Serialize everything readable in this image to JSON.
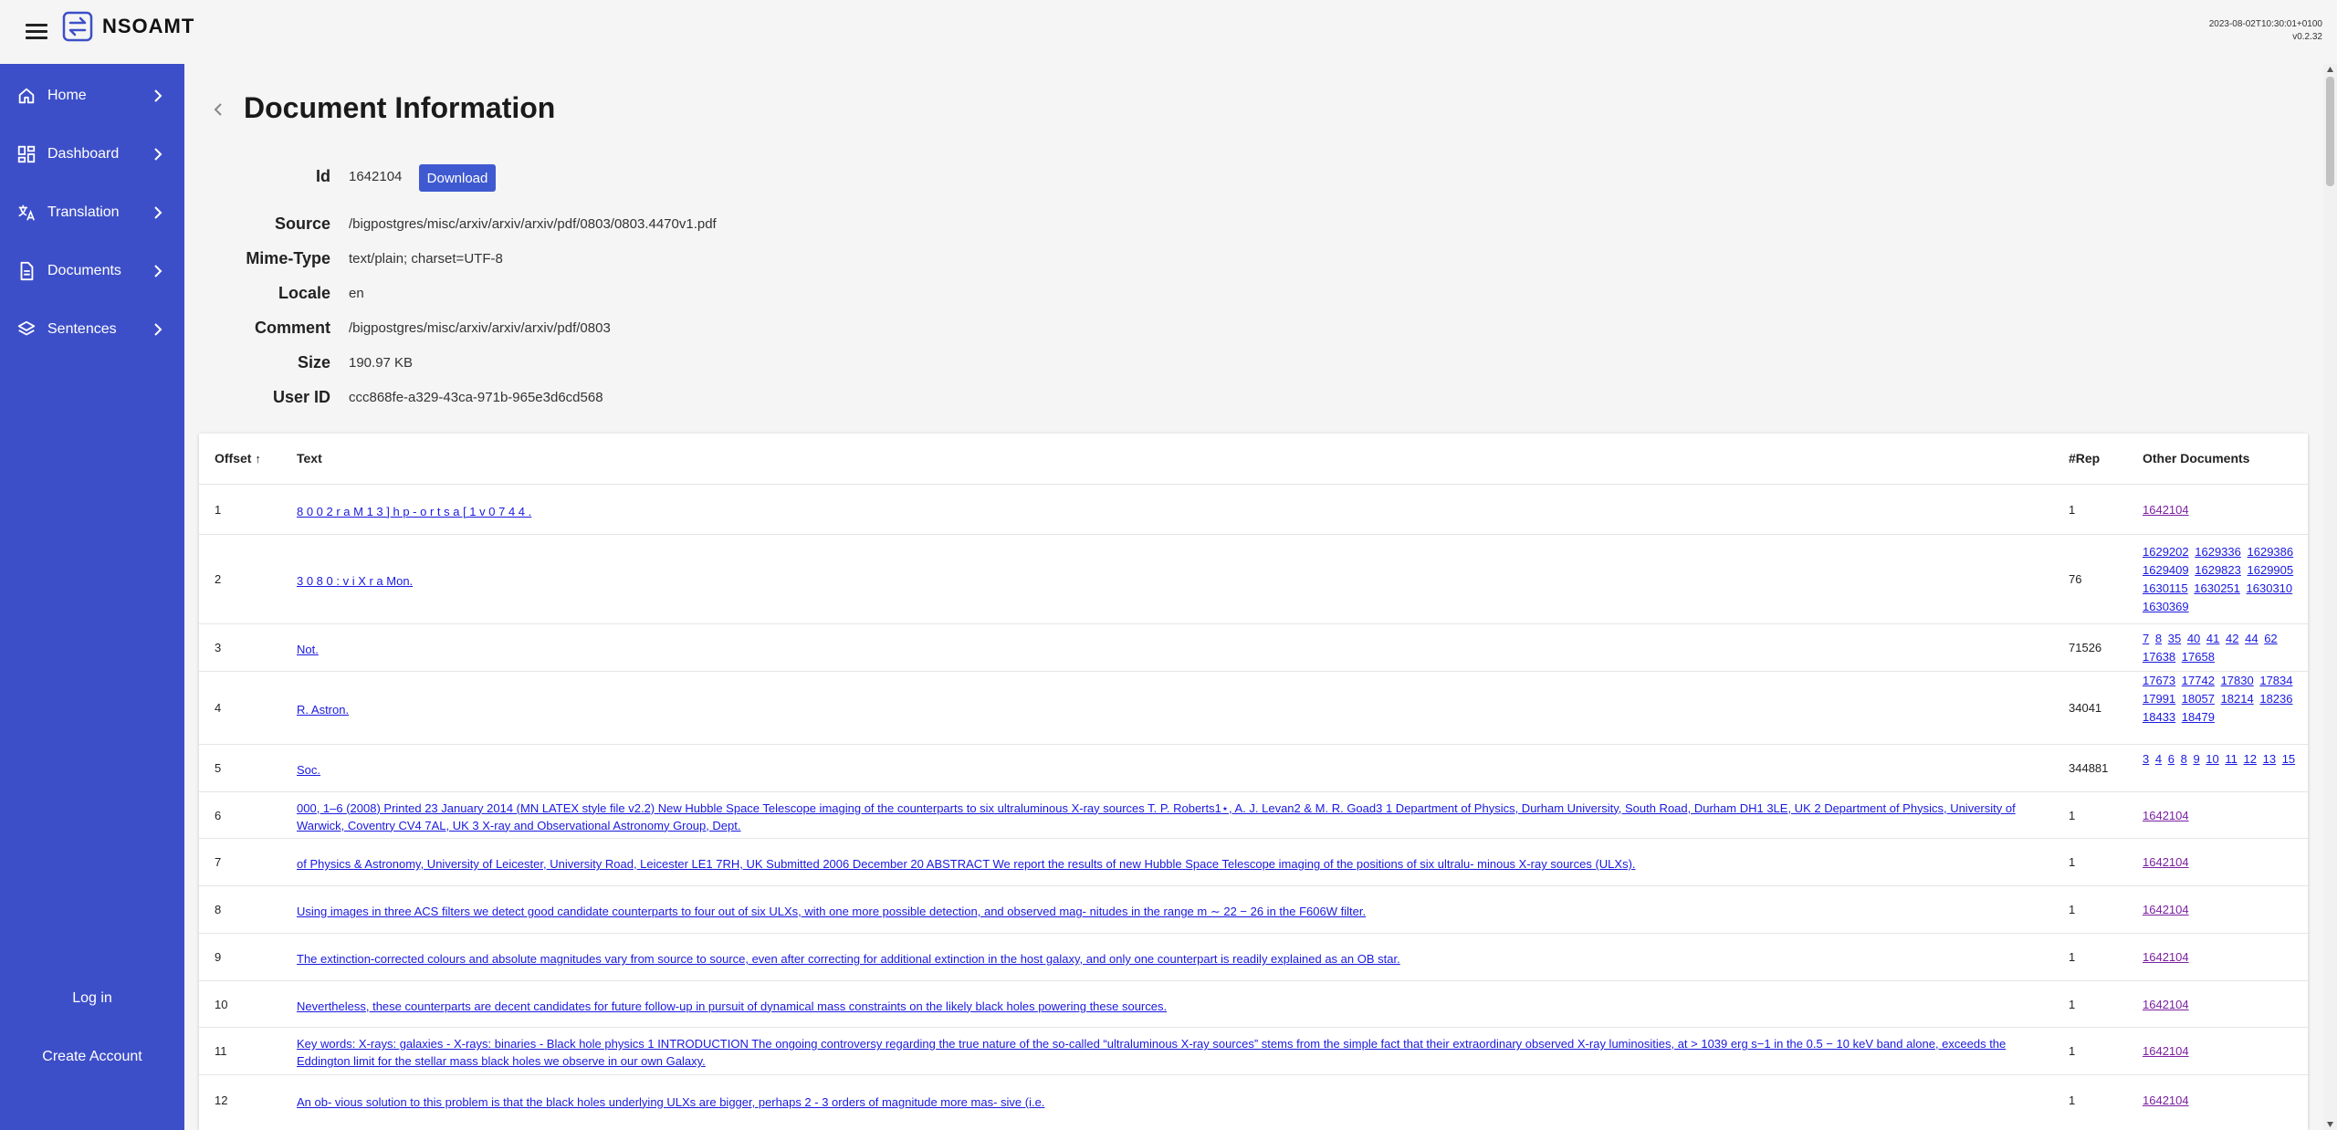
{
  "app": {
    "brand": "NSOAMT",
    "build_timestamp": "2023-08-02T10:30:01+0100",
    "version": "v0.2.32"
  },
  "sidebar": {
    "items": [
      {
        "label": "Home",
        "icon": "home-icon"
      },
      {
        "label": "Dashboard",
        "icon": "dashboard-icon"
      },
      {
        "label": "Translation",
        "icon": "translate-icon"
      },
      {
        "label": "Documents",
        "icon": "document-icon"
      },
      {
        "label": "Sentences",
        "icon": "layers-icon"
      }
    ],
    "login": "Log in",
    "create_account": "Create Account",
    "background": "#3d4fc8"
  },
  "page": {
    "title": "Document Information"
  },
  "info": {
    "id_label": "Id",
    "id": "1642104",
    "download": "Download",
    "source_label": "Source",
    "source": "/bigpostgres/misc/arxiv/arxiv/arxiv/pdf/0803/0803.4470v1.pdf",
    "mime_label": "Mime-Type",
    "mime": "text/plain; charset=UTF-8",
    "locale_label": "Locale",
    "locale": "en",
    "comment_label": "Comment",
    "comment": "/bigpostgres/misc/arxiv/arxiv/arxiv/pdf/0803",
    "size_label": "Size",
    "size": "190.97 KB",
    "user_label": "User ID",
    "user": "ccc868fe-a329-43ca-971b-965e3d6cd568"
  },
  "table": {
    "headers": {
      "offset": "Offset",
      "text": "Text",
      "rep": "#Rep",
      "docs": "Other Documents"
    },
    "rows": [
      {
        "offset": "1",
        "text": "8 0 0 2 r a M 1 3 ] h p - o r t s a [ 1 v 0 7 4 4 .",
        "rep": "1",
        "docs": [
          "1642104"
        ]
      },
      {
        "offset": "2",
        "text": "3 0 8 0 : v i X r a Mon.",
        "rep": "76",
        "docs": [
          "1629202",
          "1629336",
          "1629386",
          "1629409",
          "1629823",
          "1629905",
          "1630115",
          "1630251",
          "1630310",
          "1630369"
        ]
      },
      {
        "offset": "3",
        "text": "Not.",
        "rep": "71526",
        "docs": [
          "7",
          "8",
          "35",
          "40",
          "41",
          "42",
          "44",
          "62",
          "17638",
          "17658"
        ]
      },
      {
        "offset": "4",
        "text": "R. Astron.",
        "rep": "34041",
        "docs": [
          "17673",
          "17742",
          "17830",
          "17834",
          "17991",
          "18057",
          "18214",
          "18236",
          "18433",
          "18479"
        ]
      },
      {
        "offset": "5",
        "text": "Soc.",
        "rep": "344881",
        "docs": [
          "3",
          "4",
          "6",
          "8",
          "9",
          "10",
          "11",
          "12",
          "13",
          "15"
        ]
      },
      {
        "offset": "6",
        "text": "000, 1–6 (2008) Printed 23 January 2014 (MN LATEX style file v2.2) New Hubble Space Telescope imaging of the counterparts to six ultraluminous X-ray sources T. P. Roberts1⋆, A. J. Levan2 & M. R. Goad3 1 Department of Physics, Durham University, South Road, Durham DH1 3LE, UK 2 Department of Physics, University of Warwick, Coventry CV4 7AL, UK 3 X-ray and Observational Astronomy Group, Dept.",
        "rep": "1",
        "docs": [
          "1642104"
        ]
      },
      {
        "offset": "7",
        "text": "of Physics & Astronomy, University of Leicester, University Road, Leicester LE1 7RH, UK Submitted 2006 December 20 ABSTRACT We report the results of new Hubble Space Telescope imaging of the positions of six ultralu- minous X-ray sources (ULXs).",
        "rep": "1",
        "docs": [
          "1642104"
        ]
      },
      {
        "offset": "8",
        "text": "Using images in three ACS filters we detect good candidate counterparts to four out of six ULXs, with one more possible detection, and observed mag- nitudes in the range m ∼ 22 − 26 in the F606W filter.",
        "rep": "1",
        "docs": [
          "1642104"
        ]
      },
      {
        "offset": "9",
        "text": "The extinction-corrected colours and absolute magnitudes vary from source to source, even after correcting for additional extinction in the host galaxy, and only one counterpart is readily explained as an OB star.",
        "rep": "1",
        "docs": [
          "1642104"
        ]
      },
      {
        "offset": "10",
        "text": "Nevertheless, these counterparts are decent candidates for future follow-up in pursuit of dynamical mass constraints on the likely black holes powering these sources.",
        "rep": "1",
        "docs": [
          "1642104"
        ]
      },
      {
        "offset": "11",
        "text": "Key words: X-rays: galaxies - X-rays: binaries - Black hole physics 1 INTRODUCTION The ongoing controversy regarding the true nature of the so-called “ultraluminous X-ray sources” stems from the simple fact that their extraordinary observed X-ray luminosities, at > 1039 erg s−1 in the 0.5 − 10 keV band alone, exceeds the Eddington limit for the stellar mass black holes we observe in our own Galaxy.",
        "rep": "1",
        "docs": [
          "1642104"
        ]
      },
      {
        "offset": "12",
        "text": "An ob- vious solution to this problem is that the black holes underlying ULXs are bigger, perhaps 2 - 3 orders of magnitude more mas- sive (i.e.",
        "rep": "1",
        "docs": [
          "1642104"
        ]
      }
    ]
  }
}
